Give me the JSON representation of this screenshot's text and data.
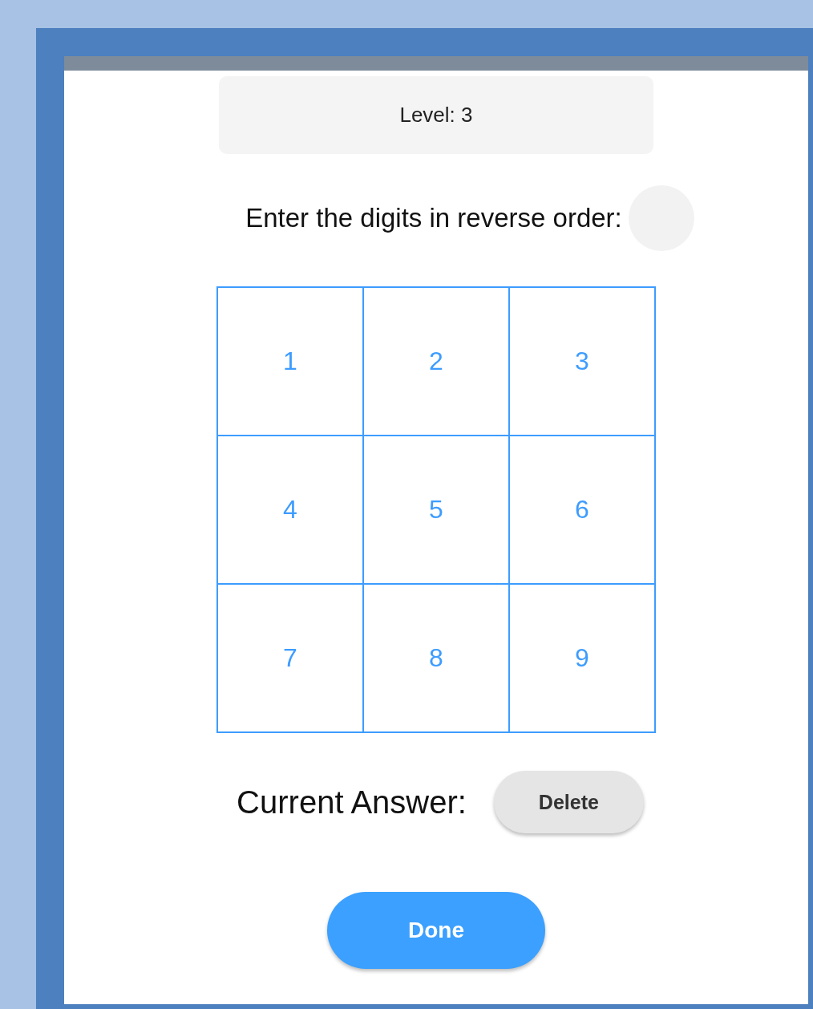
{
  "level_label": "Level: 3",
  "prompt": "Enter the digits in reverse order:",
  "keypad": [
    {
      "label": "1"
    },
    {
      "label": "2"
    },
    {
      "label": "3"
    },
    {
      "label": "4"
    },
    {
      "label": "5"
    },
    {
      "label": "6"
    },
    {
      "label": "7"
    },
    {
      "label": "8"
    },
    {
      "label": "9"
    }
  ],
  "answer_label": "Current Answer:",
  "buttons": [
    {
      "kind": "secondary",
      "label": "Delete"
    },
    {
      "kind": "primary",
      "label": "Done"
    }
  ]
}
